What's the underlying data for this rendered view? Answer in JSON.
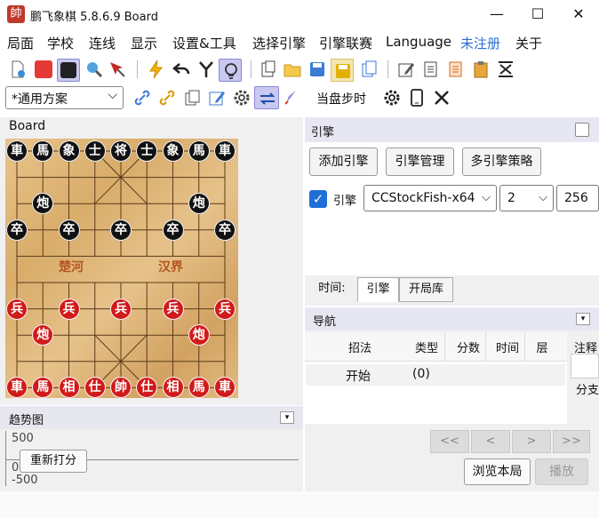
{
  "app": {
    "title": "鹏飞象棋 5.8.6.9 Board",
    "icon_char": "帥"
  },
  "window_buttons": {
    "minimize": "—",
    "maximize": "☐",
    "close": "✕"
  },
  "menu": [
    "局面",
    "学校",
    "连线",
    "显示",
    "设置&工具",
    "选择引擎",
    "引擎联赛",
    "Language",
    "未注册",
    "关于"
  ],
  "menu_accent": "#2a6fd6",
  "toolbar2": {
    "scheme": "*通用方案",
    "autoplay": "当盘步时"
  },
  "board_panel": {
    "title": "Board"
  },
  "board": {
    "river_left": "楚河",
    "river_right": "汉界",
    "black_pieces": [
      {
        "c": "車",
        "col": 0,
        "row": 0
      },
      {
        "c": "馬",
        "col": 1,
        "row": 0
      },
      {
        "c": "象",
        "col": 2,
        "row": 0
      },
      {
        "c": "士",
        "col": 3,
        "row": 0
      },
      {
        "c": "将",
        "col": 4,
        "row": 0
      },
      {
        "c": "士",
        "col": 5,
        "row": 0
      },
      {
        "c": "象",
        "col": 6,
        "row": 0
      },
      {
        "c": "馬",
        "col": 7,
        "row": 0
      },
      {
        "c": "車",
        "col": 8,
        "row": 0
      },
      {
        "c": "炮",
        "col": 1,
        "row": 2
      },
      {
        "c": "炮",
        "col": 7,
        "row": 2
      },
      {
        "c": "卒",
        "col": 0,
        "row": 3
      },
      {
        "c": "卒",
        "col": 2,
        "row": 3
      },
      {
        "c": "卒",
        "col": 4,
        "row": 3
      },
      {
        "c": "卒",
        "col": 6,
        "row": 3
      },
      {
        "c": "卒",
        "col": 8,
        "row": 3
      }
    ],
    "red_pieces": [
      {
        "c": "兵",
        "col": 0,
        "row": 6
      },
      {
        "c": "兵",
        "col": 2,
        "row": 6
      },
      {
        "c": "兵",
        "col": 4,
        "row": 6
      },
      {
        "c": "兵",
        "col": 6,
        "row": 6
      },
      {
        "c": "兵",
        "col": 8,
        "row": 6
      },
      {
        "c": "炮",
        "col": 1,
        "row": 7
      },
      {
        "c": "炮",
        "col": 7,
        "row": 7
      },
      {
        "c": "車",
        "col": 0,
        "row": 9
      },
      {
        "c": "馬",
        "col": 1,
        "row": 9
      },
      {
        "c": "相",
        "col": 2,
        "row": 9
      },
      {
        "c": "仕",
        "col": 3,
        "row": 9
      },
      {
        "c": "帥",
        "col": 4,
        "row": 9
      },
      {
        "c": "仕",
        "col": 5,
        "row": 9
      },
      {
        "c": "相",
        "col": 6,
        "row": 9
      },
      {
        "c": "馬",
        "col": 7,
        "row": 9
      },
      {
        "c": "車",
        "col": 8,
        "row": 9
      }
    ],
    "colors": {
      "black_piece": "#111111",
      "red_piece": "#d11a1a"
    }
  },
  "trend": {
    "title": "趋势图",
    "y_top": "500",
    "y_mid": "0",
    "y_bottom": "-500",
    "rescore_button": "重新打分"
  },
  "engine": {
    "title": "引擎",
    "add_button": "添加引擎",
    "manage_button": "引擎管理",
    "strategy_button": "多引擎策略",
    "engine_label": "引擎",
    "engine_name": "CCStockFish-x64",
    "threads": "2",
    "hash": "256"
  },
  "tabs": {
    "time": "时间:",
    "engine": "引擎",
    "opening": "开局库"
  },
  "navigation": {
    "title": "导航",
    "columns": [
      "招法",
      "类型",
      "分数",
      "时间",
      "层"
    ],
    "rows": [
      {
        "move": "开始",
        "type": "(0)"
      }
    ],
    "side_labels": {
      "comment": "注释",
      "branch": "分支"
    },
    "nav_buttons": [
      "<<",
      "<",
      ">",
      ">>"
    ],
    "browse_button": "浏览本局",
    "play_button": "播放"
  }
}
